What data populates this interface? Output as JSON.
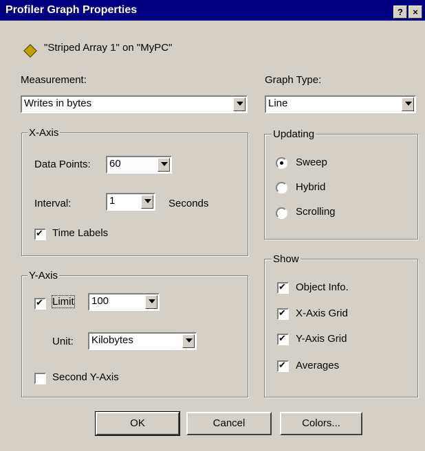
{
  "window": {
    "title": "Profiler Graph Properties",
    "help_label": "?",
    "close_label": "×"
  },
  "object": {
    "text": "\"Striped Array  1\" on \"MyPC\"",
    "icon": "diamond-icon"
  },
  "measurement": {
    "label": "Measurement:",
    "value": "Writes in bytes"
  },
  "graph_type": {
    "label": "Graph Type:",
    "value": "Line"
  },
  "x_axis": {
    "title": "X-Axis",
    "data_points_label": "Data Points:",
    "data_points_value": "60",
    "interval_label": "Interval:",
    "interval_value": "1",
    "interval_unit": "Seconds",
    "time_labels": "Time Labels",
    "time_labels_checked": true
  },
  "y_axis": {
    "title": "Y-Axis",
    "limit_label": "Limit",
    "limit_checked": true,
    "limit_value": "100",
    "unit_label": "Unit:",
    "unit_value": "Kilobytes",
    "second_label": "Second Y-Axis",
    "second_checked": false
  },
  "updating": {
    "title": "Updating",
    "options": [
      "Sweep",
      "Hybrid",
      "Scrolling"
    ],
    "selected": "Sweep"
  },
  "show": {
    "title": "Show",
    "items": [
      {
        "label": "Object Info.",
        "checked": true
      },
      {
        "label": "X-Axis Grid",
        "checked": true
      },
      {
        "label": "Y-Axis Grid",
        "checked": true
      },
      {
        "label": "Averages",
        "checked": true
      }
    ]
  },
  "buttons": {
    "ok": "OK",
    "cancel": "Cancel",
    "colors": "Colors..."
  },
  "colors": {
    "titlebar": "#000080",
    "face": "#d4d0c8"
  }
}
